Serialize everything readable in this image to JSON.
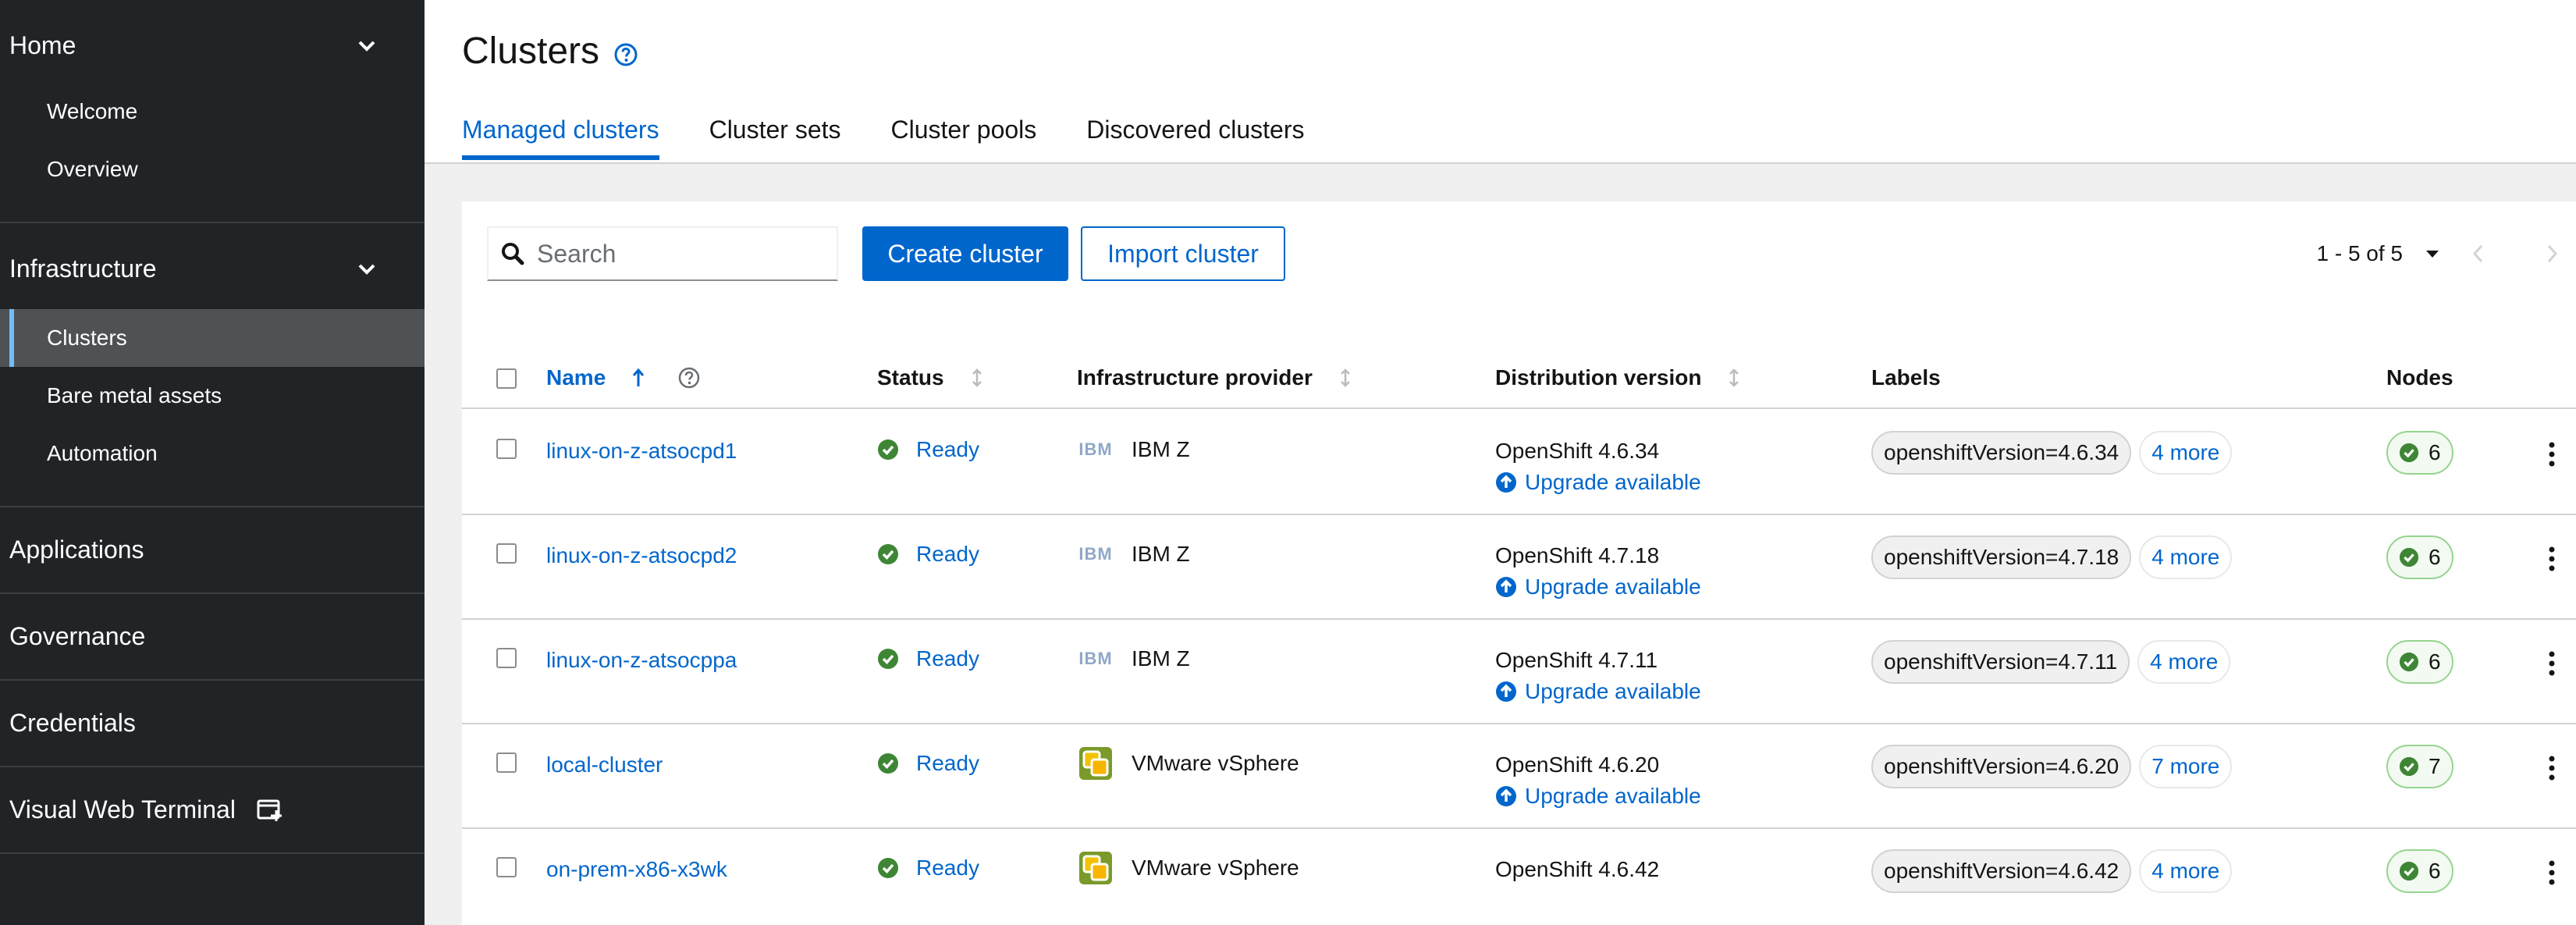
{
  "sidebar": {
    "home": {
      "label": "Home",
      "items": [
        {
          "label": "Welcome"
        },
        {
          "label": "Overview"
        }
      ]
    },
    "infrastructure": {
      "label": "Infrastructure",
      "items": [
        {
          "label": "Clusters",
          "active": true
        },
        {
          "label": "Bare metal assets"
        },
        {
          "label": "Automation"
        }
      ]
    },
    "links": [
      {
        "label": "Applications"
      },
      {
        "label": "Governance"
      },
      {
        "label": "Credentials"
      },
      {
        "label": "Visual Web Terminal"
      }
    ]
  },
  "header": {
    "title": "Clusters",
    "tabs": [
      {
        "label": "Managed clusters",
        "active": true
      },
      {
        "label": "Cluster sets"
      },
      {
        "label": "Cluster pools"
      },
      {
        "label": "Discovered clusters"
      }
    ]
  },
  "toolbar": {
    "search_placeholder": "Search",
    "create_label": "Create cluster",
    "import_label": "Import cluster",
    "pagination": "1 - 5 of 5"
  },
  "table": {
    "columns": {
      "name": "Name",
      "status": "Status",
      "provider": "Infrastructure provider",
      "version": "Distribution version",
      "labels": "Labels",
      "nodes": "Nodes"
    },
    "rows": [
      {
        "name": "linux-on-z-atsocpd1",
        "status": "Ready",
        "provider": "IBM Z",
        "provider_icon": "ibm-logo-icon",
        "version": "OpenShift 4.6.34",
        "upgrade": "Upgrade available",
        "label": "openshiftVersion=4.6.34",
        "more": "4 more",
        "nodes": "6"
      },
      {
        "name": "linux-on-z-atsocpd2",
        "status": "Ready",
        "provider": "IBM Z",
        "provider_icon": "ibm-logo-icon",
        "version": "OpenShift 4.7.18",
        "upgrade": "Upgrade available",
        "label": "openshiftVersion=4.7.18",
        "more": "4 more",
        "nodes": "6"
      },
      {
        "name": "linux-on-z-atsocppa",
        "status": "Ready",
        "provider": "IBM Z",
        "provider_icon": "ibm-logo-icon",
        "version": "OpenShift 4.7.11",
        "upgrade": "Upgrade available",
        "label": "openshiftVersion=4.7.11",
        "more": "4 more",
        "nodes": "6"
      },
      {
        "name": "local-cluster",
        "status": "Ready",
        "provider": "VMware vSphere",
        "provider_icon": "vmware-logo-icon",
        "version": "OpenShift 4.6.20",
        "upgrade": "Upgrade available",
        "label": "openshiftVersion=4.6.20",
        "more": "7 more",
        "nodes": "7"
      },
      {
        "name": "on-prem-x86-x3wk",
        "status": "Ready",
        "provider": "VMware vSphere",
        "provider_icon": "vmware-logo-icon",
        "version": "OpenShift 4.6.42",
        "upgrade": "",
        "label": "openshiftVersion=4.6.42",
        "more": "4 more",
        "nodes": "6"
      }
    ]
  },
  "colors": {
    "sidebar_bg": "#212427",
    "accent": "#0066cc",
    "success": "#3e8635"
  }
}
